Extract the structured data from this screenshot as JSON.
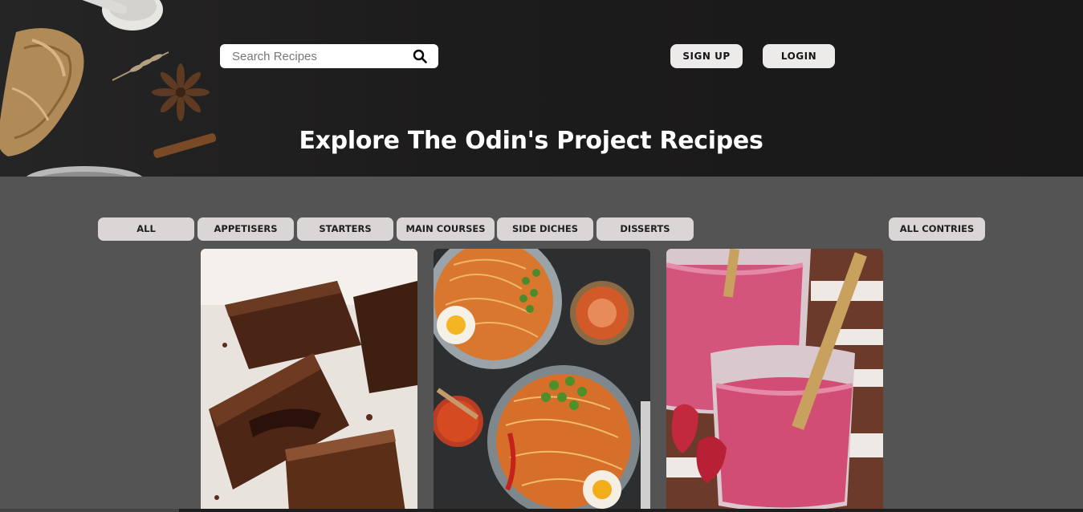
{
  "header": {
    "search": {
      "placeholder": "Search Recipes",
      "value": "",
      "icon": "search-icon"
    },
    "signup_label": "SIGN UP",
    "login_label": "LOGIN",
    "title": "Explore The Odin's Project Recipes"
  },
  "filters": {
    "categories": [
      "ALL",
      "APPETISERS",
      "STARTERS",
      "MAIN COURSES",
      "SIDE DICHES",
      "DISSERTS"
    ],
    "countries_label": "ALL CONTRIES"
  },
  "colors": {
    "page_background": "#545454",
    "hero_background": "#1d1c1c",
    "button_background": "#ecebea",
    "filter_background": "#dbd6d6",
    "title_color": "#ffffff"
  }
}
